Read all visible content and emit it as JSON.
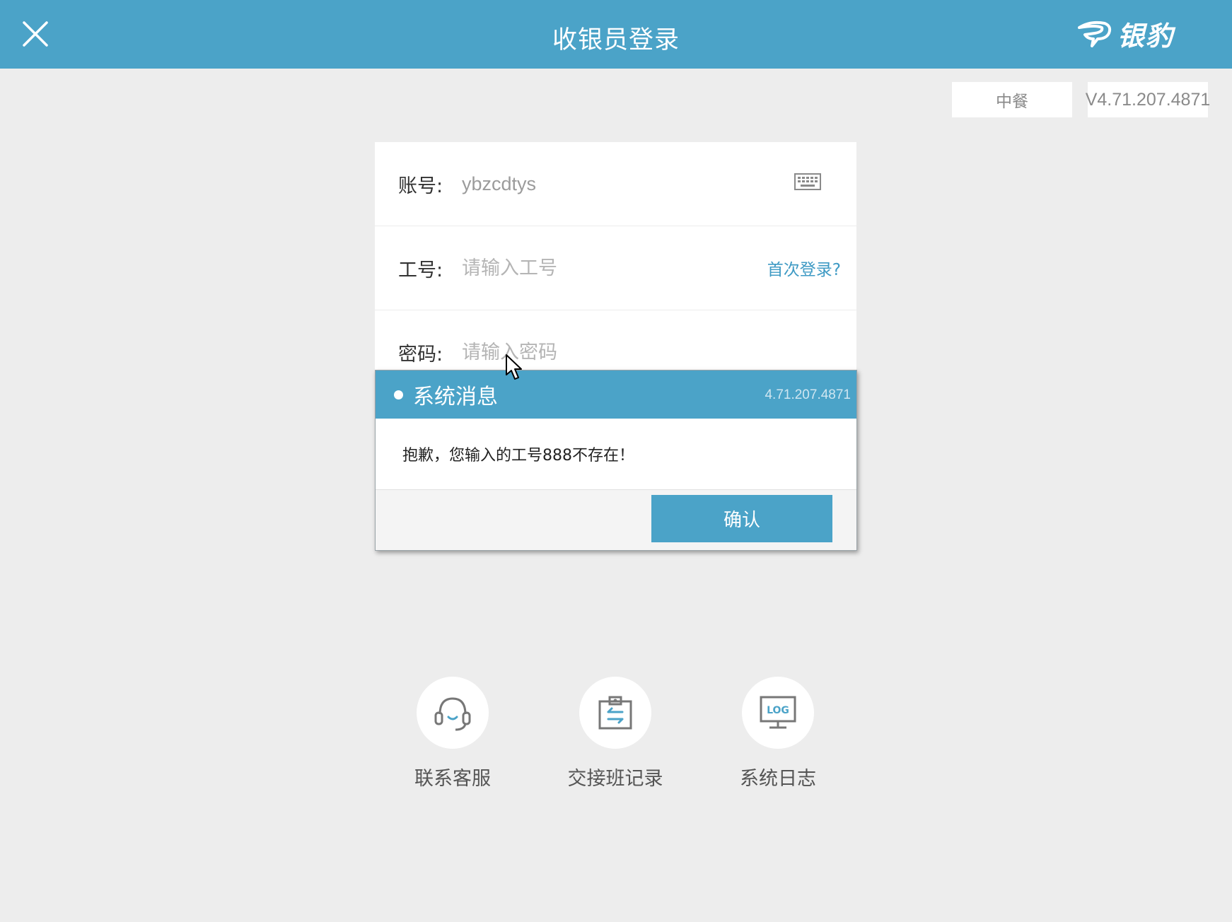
{
  "header": {
    "title": "收银员登录",
    "brand": "银豹",
    "accent_color": "#4ba3c8"
  },
  "tags": {
    "business_type": "中餐",
    "version": "V4.71.207.4871"
  },
  "form": {
    "account_label": "账号:",
    "account_value": "ybzcdtys",
    "job_label": "工号:",
    "job_placeholder": "请输入工号",
    "first_login": "首次登录?",
    "password_label": "密码:",
    "password_placeholder": "请输入密码"
  },
  "dialog": {
    "title": "系统消息",
    "version": "4.71.207.4871",
    "message": "抱歉，您输入的工号888不存在！",
    "confirm_label": "确认"
  },
  "tools": {
    "support_label": "联系客服",
    "shift_label": "交接班记录",
    "log_label": "系统日志",
    "log_icon_text": "LOG"
  }
}
